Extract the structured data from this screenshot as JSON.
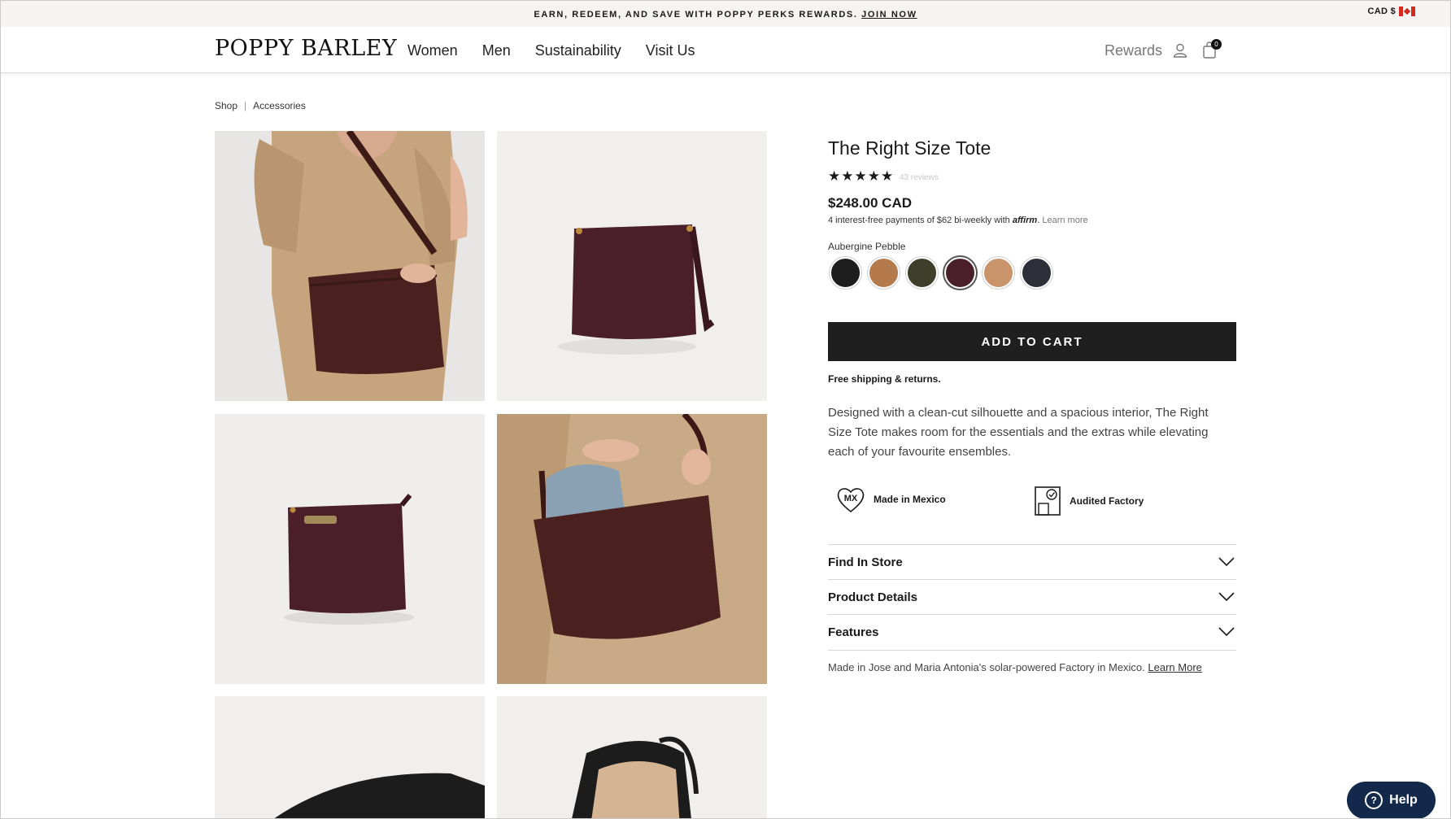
{
  "promo": {
    "text": "EARN, REDEEM, AND SAVE WITH POPPY PERKS REWARDS.",
    "link": "JOIN NOW"
  },
  "currency": {
    "label": "CAD $",
    "flag_icon": "canada-flag-icon"
  },
  "header": {
    "logo": "POPPY BARLEY",
    "nav": [
      "Women",
      "Men",
      "Sustainability",
      "Visit Us"
    ],
    "rewards": "Rewards",
    "cart_count": "0"
  },
  "breadcrumb": {
    "items": [
      "Shop",
      "Accessories"
    ],
    "separator": "|"
  },
  "product": {
    "title": "The Right Size Tote",
    "rating": 5,
    "stars": "★★★★★",
    "reviews": "43 reviews",
    "price": "$248.00 CAD",
    "affirm": {
      "prefix": "4 interest-free payments of $62 bi-weekly with",
      "logo": "affirm",
      "link": "Learn more"
    },
    "color_name": "Aubergine Pebble",
    "swatch_colors": [
      "#1e1e1e",
      "#b57a4b",
      "#3d3f2a",
      "#4a1f2a",
      "#c9946b",
      "#2c2f38"
    ],
    "selected_swatch_index": 3,
    "add_to_cart": "ADD TO CART",
    "shipping": "Free shipping & returns.",
    "description": "Designed with a clean-cut silhouette and a spacious interior, The Right Size Tote makes room for the essentials and the extras while elevating each of your favourite ensembles.",
    "badges": [
      {
        "icon": "heart-mx-icon",
        "icon_text": "MX",
        "label": "Made in Mexico"
      },
      {
        "icon": "audited-factory-icon",
        "label": "Audited Factory"
      }
    ],
    "accordions": [
      "Find In Store",
      "Product Details",
      "Features"
    ],
    "factory_note": "Made in Jose and Maria Antonia's solar-powered Factory in Mexico.",
    "factory_link": "Learn More"
  },
  "help": {
    "label": "Help"
  },
  "colors": {
    "dark": "#1f1f1f",
    "help_bg": "#13294b",
    "bag": "#4a1f2a"
  }
}
